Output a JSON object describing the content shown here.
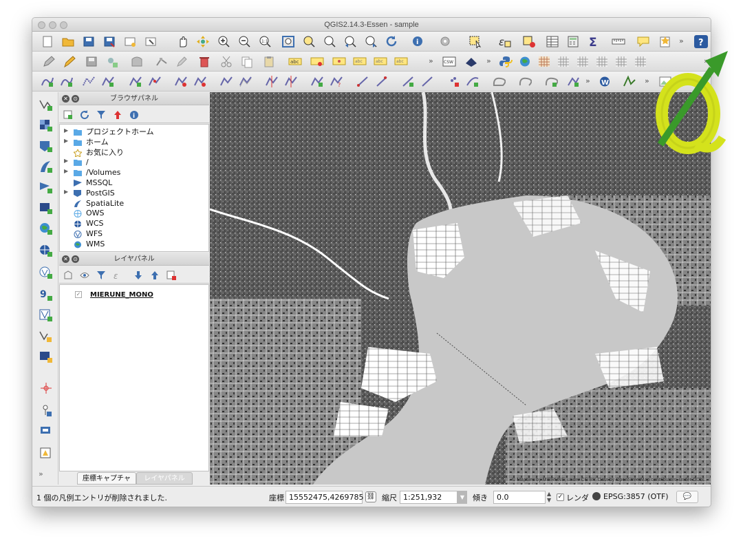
{
  "window": {
    "title": "QGIS2.14.3-Essen - sample"
  },
  "browser_panel": {
    "title": "ブラウザパネル",
    "items": [
      {
        "label": "プロジェクトホーム",
        "icon": "folder-icon",
        "expandable": true
      },
      {
        "label": "ホーム",
        "icon": "folder-icon",
        "expandable": true
      },
      {
        "label": "お気に入り",
        "icon": "star-icon",
        "expandable": false
      },
      {
        "label": "/",
        "icon": "folder-icon",
        "expandable": true
      },
      {
        "label": "/Volumes",
        "icon": "folder-icon",
        "expandable": true
      },
      {
        "label": "MSSQL",
        "icon": "mssql-icon",
        "expandable": false
      },
      {
        "label": "PostGIS",
        "icon": "postgis-icon",
        "expandable": true
      },
      {
        "label": "SpatiaLite",
        "icon": "spatialite-icon",
        "expandable": false
      },
      {
        "label": "OWS",
        "icon": "ows-icon",
        "expandable": false
      },
      {
        "label": "WCS",
        "icon": "wcs-icon",
        "expandable": false
      },
      {
        "label": "WFS",
        "icon": "wfs-icon",
        "expandable": false
      },
      {
        "label": "WMS",
        "icon": "wms-icon",
        "expandable": false
      }
    ]
  },
  "layer_panel": {
    "title": "レイヤパネル",
    "layers": [
      {
        "name": "MIERUNE_MONO",
        "visible": true
      }
    ]
  },
  "tabs": {
    "active": "座標キャプチャ",
    "inactive": "レイヤパネル"
  },
  "map": {
    "attribution": "© Maptiles by MIERUNE, under CC BY. Data by OpenStreetMap contributors, under ODbL."
  },
  "toolbar": {
    "csw_label": "CSW",
    "abc_label": "abc"
  },
  "statusbar": {
    "message": "1 個の凡例エントリが削除されました.",
    "coord_label": "座標",
    "coord_value": "15552475,4269785",
    "scale_label": "縮尺",
    "scale_value": "1:251,932",
    "rotation_label": "傾き",
    "rotation_value": "0.0",
    "render_label": "レンダ",
    "render_checked": true,
    "crs_label": "EPSG:3857 (OTF)"
  },
  "colors": {
    "folder": "#5aa9e6",
    "accent_green": "#3a9a2a",
    "qgis_yellow": "#d4e21c",
    "map_water": "#c8c8c8",
    "map_land": "#6f6f6f"
  }
}
